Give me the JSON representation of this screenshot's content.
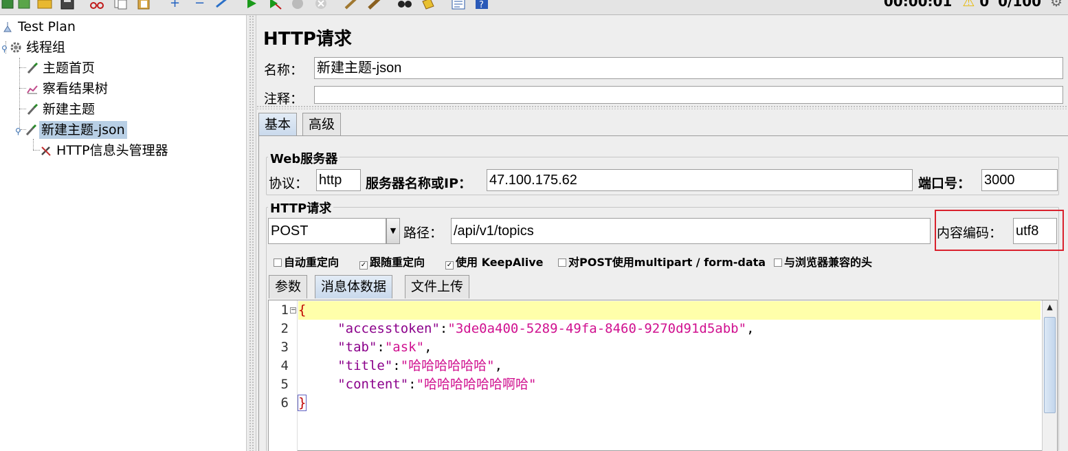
{
  "toolbar": {
    "timer": "00:00:01",
    "warn_count": "0",
    "threads": "0/100"
  },
  "tree": {
    "root": "Test Plan",
    "thread_group": "线程组",
    "items": [
      {
        "label": "主题首页"
      },
      {
        "label": "察看结果树"
      },
      {
        "label": "新建主题"
      },
      {
        "label": "新建主题-json"
      }
    ],
    "child": "HTTP信息头管理器"
  },
  "panel": {
    "title": "HTTP请求",
    "name_label": "名称：",
    "name_value": "新建主题-json",
    "comment_label": "注释：",
    "comment_value": "",
    "tabs": [
      "基本",
      "高级"
    ],
    "web_server": {
      "title": "Web服务器",
      "protocol_label": "协议：",
      "protocol_value": "http",
      "server_label": "服务器名称或IP：",
      "server_value": "47.100.175.62",
      "port_label": "端口号：",
      "port_value": "3000"
    },
    "http_request": {
      "title": "HTTP请求",
      "method_value": "POST",
      "path_label": "路径：",
      "path_value": "/api/v1/topics",
      "encoding_label": "内容编码：",
      "encoding_value": "utf8"
    },
    "checkboxes": [
      {
        "label": "自动重定向",
        "checked": false
      },
      {
        "label": "跟随重定向",
        "checked": true
      },
      {
        "label": "使用 KeepAlive",
        "checked": true
      },
      {
        "label": "对POST使用multipart / form-data",
        "checked": false
      },
      {
        "label": "与浏览器兼容的头",
        "checked": false
      }
    ],
    "body_tabs": [
      "参数",
      "消息体数据",
      "文件上传"
    ],
    "editor": {
      "line_numbers": [
        "1",
        "2",
        "3",
        "4",
        "5",
        "6"
      ],
      "lines": {
        "l1": "{",
        "l2_key": "\"accesstoken\"",
        "l2_val": "\"3de0a400-5289-49fa-8460-9270d91d5abb\"",
        "l3_key": "\"tab\"",
        "l3_val": "\"ask\"",
        "l4_key": "\"title\"",
        "l4_val": "\"哈哈哈哈哈哈\"",
        "l5_key": "\"content\"",
        "l5_val": "\"哈哈哈哈哈哈啊哈\"",
        "l6": "}"
      }
    }
  }
}
